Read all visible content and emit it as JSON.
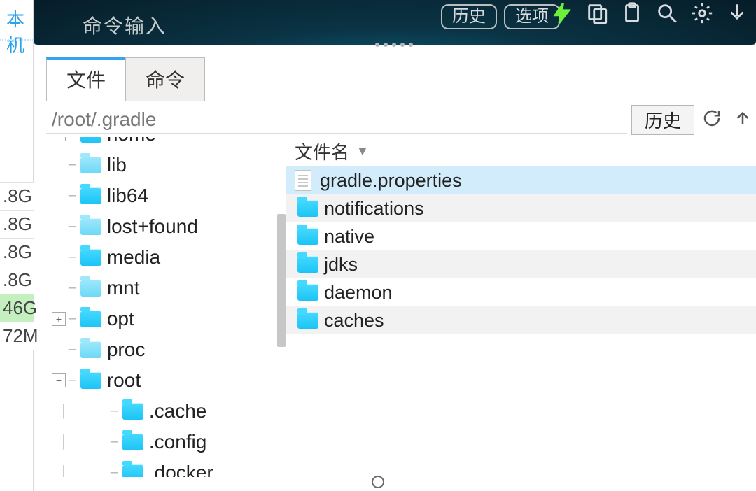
{
  "left_panel": {
    "local_label": "本机",
    "sizes": [
      {
        "text": ".8G",
        "hl": false
      },
      {
        "text": ".8G",
        "hl": false
      },
      {
        "text": ".8G",
        "hl": false
      },
      {
        "text": ".8G",
        "hl": false
      },
      {
        "text": "46G",
        "hl": true
      },
      {
        "text": "72M",
        "hl": false
      }
    ]
  },
  "topbar": {
    "cmd_placeholder": "命令输入",
    "history_btn": "历史",
    "options_btn": "选项"
  },
  "tabs": {
    "files": "文件",
    "commands": "命令"
  },
  "pathbar": {
    "path": "/root/.gradle",
    "history_btn": "历史"
  },
  "tree": [
    {
      "indent": 0,
      "exp": "plus",
      "dim": false,
      "label": "home",
      "cut_top": true
    },
    {
      "indent": 0,
      "exp": "",
      "dim": true,
      "label": "lib"
    },
    {
      "indent": 0,
      "exp": "",
      "dim": false,
      "label": "lib64"
    },
    {
      "indent": 0,
      "exp": "",
      "dim": true,
      "label": "lost+found"
    },
    {
      "indent": 0,
      "exp": "",
      "dim": false,
      "label": "media"
    },
    {
      "indent": 0,
      "exp": "",
      "dim": true,
      "label": "mnt"
    },
    {
      "indent": 0,
      "exp": "plus",
      "dim": false,
      "label": "opt"
    },
    {
      "indent": 0,
      "exp": "",
      "dim": true,
      "label": "proc"
    },
    {
      "indent": 0,
      "exp": "minus",
      "dim": false,
      "label": "root"
    },
    {
      "indent": 1,
      "exp": "",
      "dim": false,
      "label": ".cache"
    },
    {
      "indent": 1,
      "exp": "",
      "dim": false,
      "label": ".config"
    },
    {
      "indent": 1,
      "exp": "",
      "dim": false,
      "label": ".docker"
    }
  ],
  "filelist": {
    "header": "文件名",
    "rows": [
      {
        "type": "file",
        "name": "gradle.properties",
        "sel": true
      },
      {
        "type": "folder",
        "name": "notifications",
        "alt": true
      },
      {
        "type": "folder",
        "name": "native"
      },
      {
        "type": "folder",
        "name": "jdks",
        "alt": true
      },
      {
        "type": "folder",
        "name": "daemon"
      },
      {
        "type": "folder",
        "name": "caches",
        "alt": true
      }
    ]
  }
}
